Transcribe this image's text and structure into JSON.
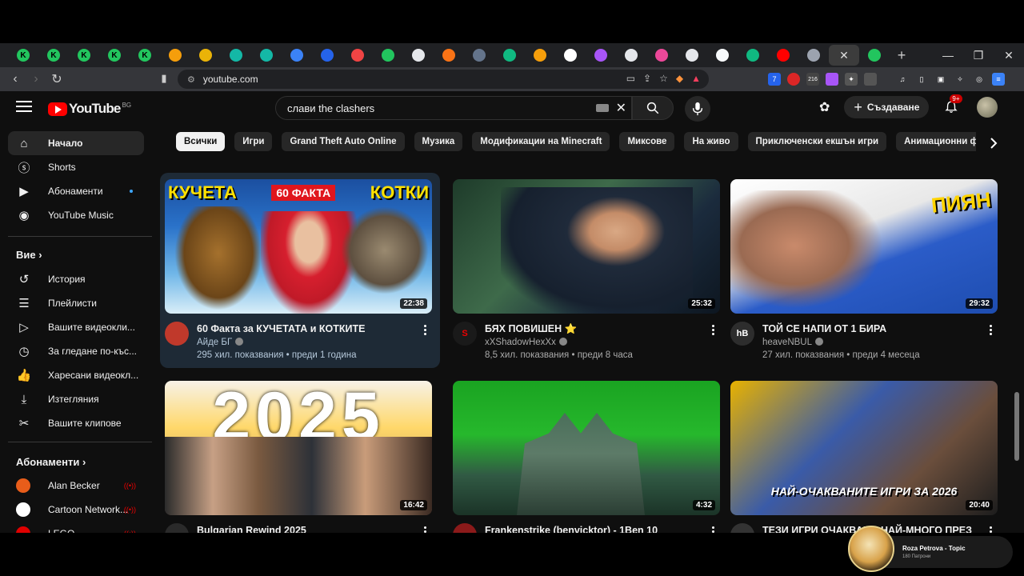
{
  "browser": {
    "tabs": [
      {
        "letter": "K",
        "color": "#22c55e"
      },
      {
        "letter": "K",
        "color": "#22c55e"
      },
      {
        "letter": "K",
        "color": "#22c55e"
      },
      {
        "letter": "K",
        "color": "#22c55e"
      },
      {
        "letter": "K",
        "color": "#22c55e"
      },
      {
        "letter": "",
        "color": "#f59e0b"
      },
      {
        "letter": "",
        "color": "#eab308"
      },
      {
        "letter": "",
        "color": "#14b8a6"
      },
      {
        "letter": "",
        "color": "#14b8a6"
      },
      {
        "letter": "",
        "color": "#3b82f6"
      },
      {
        "letter": "",
        "color": "#2563eb"
      },
      {
        "letter": "",
        "color": "#ef4444"
      },
      {
        "letter": "",
        "color": "#22c55e"
      },
      {
        "letter": "",
        "color": "#e5e7eb"
      },
      {
        "letter": "",
        "color": "#f97316"
      },
      {
        "letter": "",
        "color": "#64748b"
      },
      {
        "letter": "",
        "color": "#10b981"
      },
      {
        "letter": "",
        "color": "#f59e0b"
      },
      {
        "letter": "",
        "color": "#ffffff"
      },
      {
        "letter": "",
        "color": "#a855f7"
      },
      {
        "letter": "",
        "color": "#e5e7eb"
      },
      {
        "letter": "",
        "color": "#ec4899"
      },
      {
        "letter": "",
        "color": "#e5e7eb"
      },
      {
        "letter": "",
        "color": "#f8fafc"
      },
      {
        "letter": "",
        "color": "#10b981"
      },
      {
        "letter": "",
        "color": "#ff0000"
      },
      {
        "letter": "",
        "color": "#9ca3af"
      }
    ],
    "active_tab_close": "✕",
    "new_tab": "+",
    "url": "youtube.com",
    "ext_badge": "216"
  },
  "youtube": {
    "logo_text": "YouTube",
    "country": "BG",
    "search_value": "слави the clashers",
    "create_label": "Създаване",
    "notif_badge": "9+",
    "sidebar": {
      "main": [
        {
          "label": "Начало",
          "icon": "home-icon"
        },
        {
          "label": "Shorts",
          "icon": "shorts-icon"
        },
        {
          "label": "Абонаменти",
          "icon": "subscriptions-icon"
        },
        {
          "label": "YouTube Music",
          "icon": "music-icon"
        }
      ],
      "you_heading": "Вие",
      "you": [
        {
          "label": "История",
          "icon": "history-icon"
        },
        {
          "label": "Плейлисти",
          "icon": "playlist-icon"
        },
        {
          "label": "Вашите видеокли...",
          "icon": "your-videos-icon"
        },
        {
          "label": "За гледане по-къс...",
          "icon": "watch-later-icon"
        },
        {
          "label": "Харесани видеокл...",
          "icon": "like-icon"
        },
        {
          "label": "Изтегляния",
          "icon": "download-icon"
        },
        {
          "label": "Вашите клипове",
          "icon": "clips-icon"
        }
      ],
      "subs_heading": "Абонаменти",
      "subs": [
        {
          "label": "Alan Becker",
          "color": "#e85d1a"
        },
        {
          "label": "Cartoon Network...",
          "color": "#ffffff"
        },
        {
          "label": "LEGO",
          "color": "#e00000"
        }
      ]
    },
    "chips": [
      "Всички",
      "Игри",
      "Grand Theft Auto Online",
      "Музика",
      "Модификации на Minecraft",
      "Миксове",
      "На живо",
      "Приключенски екшън игри",
      "Анимационни филми"
    ],
    "videos": [
      {
        "title": "60 Факта за КУЧЕТАТА и КОТКИТЕ",
        "channel": "Айде БГ",
        "stats": "295 хил. показвания • преди 1 година",
        "duration": "22:38",
        "thumb_text_left": "КУЧЕТА",
        "thumb_text_mid": "60 ФАКТА",
        "thumb_text_right": "КОТКИ"
      },
      {
        "title": "БЯХ ПОВИШЕН ⭐",
        "channel": "xXShadowHexXx",
        "stats": "8,5 хил. показвания • преди 8 часа",
        "duration": "25:32"
      },
      {
        "title": "ТОЙ СЕ НАПИ ОТ 1 БИРА",
        "channel": "heaveNBUL",
        "stats": "27 хил. показвания • преди 4 месеца",
        "duration": "29:32",
        "thumb_text": "ПИЯН"
      },
      {
        "title": "Bulgarian Rewind 2025",
        "channel": "",
        "stats": "",
        "duration": "16:42",
        "thumb_text": "2025"
      },
      {
        "title": "Frankenstrike (benvicktor) - 1Ben 10",
        "channel": "",
        "stats": "",
        "duration": "4:32"
      },
      {
        "title": "ТЕЗИ ИГРИ ОЧАКВАМЕ НАЙ-МНОГО ПРЕЗ",
        "channel": "",
        "stats": "",
        "duration": "20:40",
        "thumb_text": "НАЙ-ОЧАКВАНИТЕ ИГРИ ЗА 2026"
      }
    ]
  },
  "miniplayer": {
    "title": "Roza Petrova - Topic",
    "subtitle": "180 Патрони"
  }
}
